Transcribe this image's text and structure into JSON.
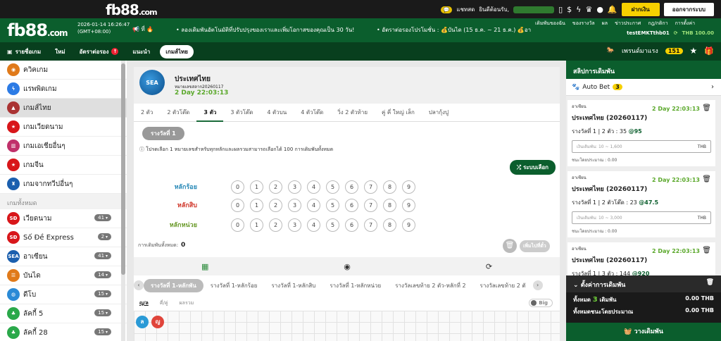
{
  "topbar": {
    "logo": "fb88",
    "logo_suffix": ".com",
    "chat_label": "แชทสด",
    "welcome": "ยินดีต้อนรับ,",
    "deposit_label": "ฝากเงิน",
    "logout_label": "ออกจากระบบ"
  },
  "header": {
    "logo": "fb88",
    "logo_suffix": ".com",
    "date": "2026-01-14 16:26:47",
    "tz": "(GMT+08:00)",
    "marquee_prefix": "ที่",
    "marquee": "• ลองเดิมพันอัตโนมัติที่ปรับปรุงของเราและเพิ่มโอกาสของคุณเป็น 30 วัน!",
    "promo": "• อัตราต่อรองโปรโมชั่น : 💰บันได (15 ธ.ค. ~ 21 ธ.ค.) 💰อา",
    "links": [
      "เดิมพันของฉัน",
      "ของรางวัล",
      "ผล",
      "ข่าวประกาศ",
      "กฎ/กติกา",
      "การตั้งค่า"
    ],
    "username": "testEMKTthb01",
    "balance": "THB 100.00"
  },
  "nav": {
    "items": [
      "รายชื่อเกม",
      "ใหม่",
      "อัตราต่อรอง",
      "แนะนำ",
      "เกมส์ไทย"
    ],
    "popular": "เพรนด์มาแรง",
    "popular_count": "151"
  },
  "sidebar": {
    "top_items": [
      "ควิคเกม",
      "แรพพิดเกม",
      "เกมส์ไทย",
      "เกมเวียดนาม",
      "เกมเอเชียอื่นๆ",
      "เกมจีน",
      "เกมจากทวีปอื่นๆ"
    ],
    "section_label": "เกมทั้งหมด",
    "games": [
      {
        "label": "เวียดนาม",
        "count": "41"
      },
      {
        "label": "Số Đề Express",
        "count": "2"
      },
      {
        "label": "อาเซียน",
        "count": "41"
      },
      {
        "label": "บันได",
        "count": "14"
      },
      {
        "label": "ดีโบ",
        "count": "15"
      },
      {
        "label": "ลัคกี้ 5",
        "count": "15"
      },
      {
        "label": "ลัคกี้ 28",
        "count": "15"
      }
    ]
  },
  "game": {
    "logo_text": "SEA",
    "title": "ประเทศไทย",
    "draw_no": "หมายเลขสลาก20260117",
    "countdown": "2 Day 22:03:13",
    "tabs": [
      "2 ตัว",
      "2 ตัวโต๊ด",
      "3 ตัว",
      "3 ตัวโต๊ด",
      "4 ตัวบน",
      "4 ตัวโต๊ด",
      "วิ่ง 2 ตัวท้าย",
      "คู่ คี่ ใหญ่ เล็ก",
      "ปลากุ้งปู"
    ],
    "round_label": "รางวัลที่ 1",
    "info": "โปรดเลือก 1 หมายเลขสำหรับทุกหลักและผลรวมสามารถเลือกได้ 100 การเดิมพันทั้งหมด",
    "random_label": "ระบบเลือก",
    "rows": [
      "หลักร้อย",
      "หลักสิบ",
      "หลักหน่วย"
    ],
    "digits": [
      "0",
      "1",
      "2",
      "3",
      "4",
      "5",
      "6",
      "7",
      "8",
      "9"
    ],
    "total_label": "การเดิมพันทั้งหมด:",
    "total_value": "0",
    "add_label": "เพิ่มไปที่ตั๋ว",
    "result_tabs": [
      "รางวัลที่ 1-หลักพัน",
      "รางวัลที่ 1-หลักร้อย",
      "รางวัลที่ 1-หลักสิบ",
      "รางวัลที่ 1-หลักหน่วย",
      "รางวัลเลขท้าย 2 ตัว-หลักที่ 2",
      "รางวัลเลขท้าย 2 ตั"
    ],
    "sub_tabs": [
      "ญ/ล",
      "คี่/คู่",
      "ผลรวม"
    ],
    "toggle_label": "Big",
    "balls": [
      "ล",
      "ญ"
    ]
  },
  "betslip": {
    "title": "สลิปการเดิมพัน",
    "autobet": "Auto Bet",
    "autobet_count": "3",
    "cards": [
      {
        "type": "อาเซียน",
        "time": "2 Day 22:03:13",
        "title": "ประเทศไทย (20260117)",
        "round": "รางวัลที่ 1 | 2 ตัว : 35 ",
        "odds": "@95",
        "placeholder": "เงินเดิมพัน: 10 ~ 1,600",
        "currency": "THB",
        "win": "ชนะโดยประมาณ : 0.00"
      },
      {
        "type": "อาเซียน",
        "time": "2 Day 22:03:13",
        "title": "ประเทศไทย (20260117)",
        "round": "รางวัลที่ 1 | 2 ตัวโต๊ด : 23 ",
        "odds": "@47.5",
        "placeholder": "เงินเดิมพัน: 10 ~ 3,000",
        "currency": "THB",
        "win": "ชนะโดยประมาณ : 0.00"
      },
      {
        "type": "อาเซียน",
        "time": "2 Day 22:03:13",
        "title": "ประเทศไทย (20260117)",
        "round": "รางวัลที่ 1 | 3 ตัว : 144 ",
        "odds": "@920"
      }
    ],
    "settings_title": "ตั้งค่าการเดิมพัน",
    "total_label": "ทั้งหมด",
    "total_count": "3",
    "total_bets": "เดิมพัน",
    "total_amount": "0.00 THB",
    "est_label": "ทั้งหมดชนะโดยประมาณ",
    "est_amount": "0.00 THB",
    "place_label": "วางเดิมพัน"
  }
}
